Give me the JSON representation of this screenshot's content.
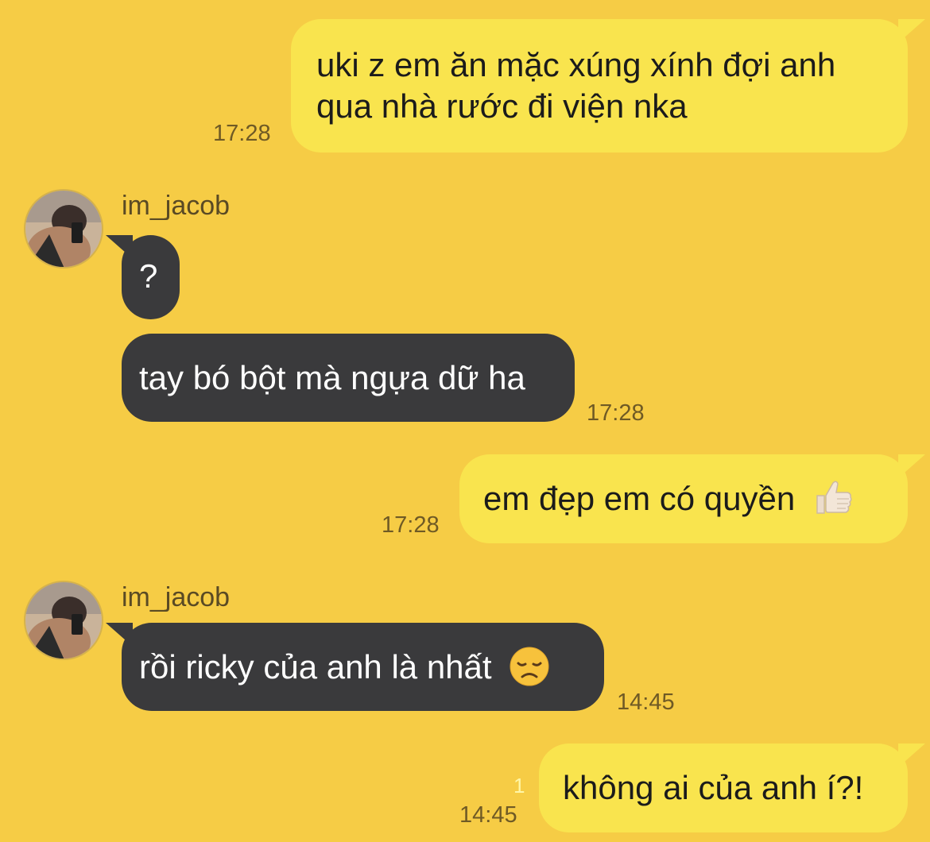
{
  "contact": {
    "name": "im_jacob"
  },
  "messages": [
    {
      "dir": "out",
      "lines": [
        "uki z em ăn mặc xúng xính đợi anh",
        "qua nhà rước đi viện nka"
      ],
      "time": "17:28"
    },
    {
      "dir": "in",
      "text": "?"
    },
    {
      "dir": "in",
      "text": "tay bó bột mà ngựa dữ ha",
      "time": "17:28"
    },
    {
      "dir": "out",
      "text": "em đẹp em có quyền",
      "emoji": "thumbs-up-icon",
      "time": "17:28"
    },
    {
      "dir": "in",
      "text": "rồi ricky của anh là nhất",
      "emoji": "disappointed-face-icon",
      "time": "14:45"
    },
    {
      "dir": "out",
      "text": "không ai của anh í?!",
      "time": "14:45",
      "unread": "1"
    }
  ],
  "colors": {
    "background": "#f6cc45",
    "outgoing_bubble": "#f9e44e",
    "incoming_bubble": "#3a3a3c"
  }
}
